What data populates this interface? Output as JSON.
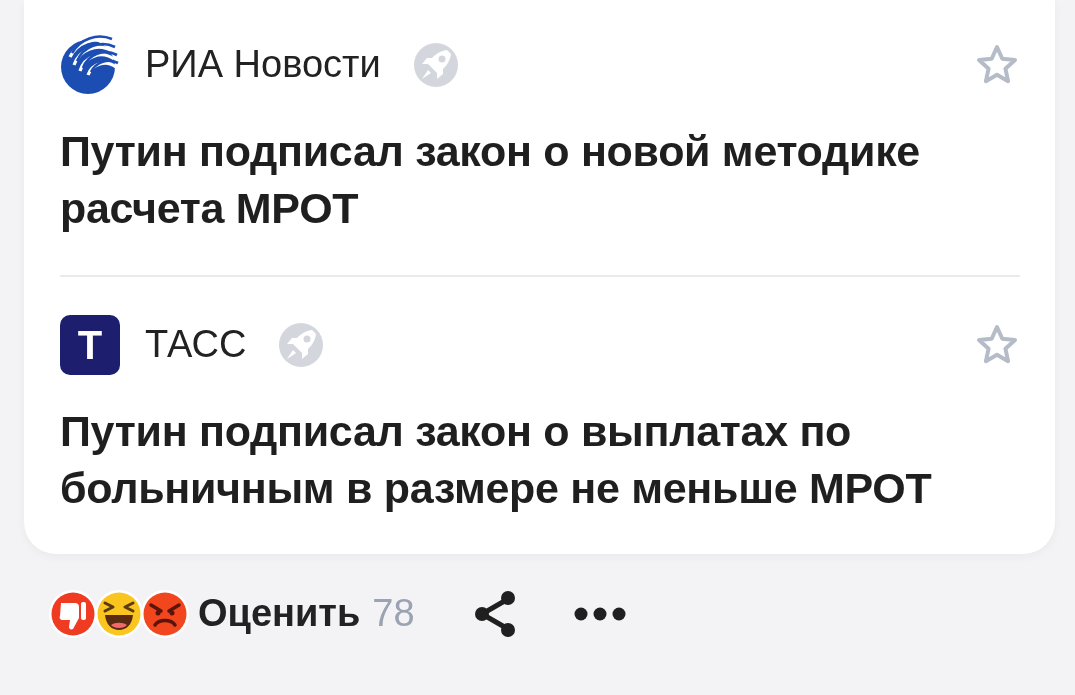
{
  "news_items": [
    {
      "source": "РИА Новости",
      "logo": {
        "kind": "globe"
      },
      "headline": "Путин подписал закон о новой методике расчета МРОТ",
      "bookmarked": false
    },
    {
      "source": "ТАСС",
      "logo": {
        "kind": "letter",
        "text": "Т"
      },
      "headline": "Путин подписал закон о выплатах по больничным в размере не меньше МРОТ",
      "bookmarked": false
    }
  ],
  "footer": {
    "reactions": [
      {
        "kind": "thumbs_down"
      },
      {
        "kind": "laughing"
      },
      {
        "kind": "angry"
      }
    ],
    "rate_label": "Оценить",
    "rate_count": "78"
  }
}
